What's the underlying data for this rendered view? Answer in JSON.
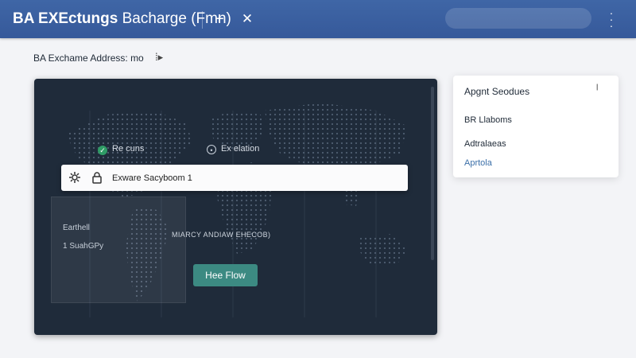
{
  "app": {
    "title_strong": "BA EXEctungs",
    "title_rest": " Bacharge (Fmn)"
  },
  "address": {
    "label": "BA Exchame Address: mo",
    "caret": "⁞▸"
  },
  "map": {
    "legend": [
      "Re cuns",
      "Ex elation"
    ],
    "side_card": [
      "Earthell",
      "1 SuahGPy"
    ],
    "caption": "MIARCY ANDIAW EHECOB)",
    "button_label": "Hee Flow",
    "search_text": "Exware Sacyboom 1"
  },
  "panel": {
    "title": "Apgnt Seodues",
    "items": [
      "BR Llaboms",
      "Adtralaeas",
      "Aprtola"
    ]
  },
  "colors": {
    "topbar": "#3f66a6",
    "map_bg": "#1f2b3a",
    "button": "#3c8a82",
    "link": "#3b6fa8"
  }
}
